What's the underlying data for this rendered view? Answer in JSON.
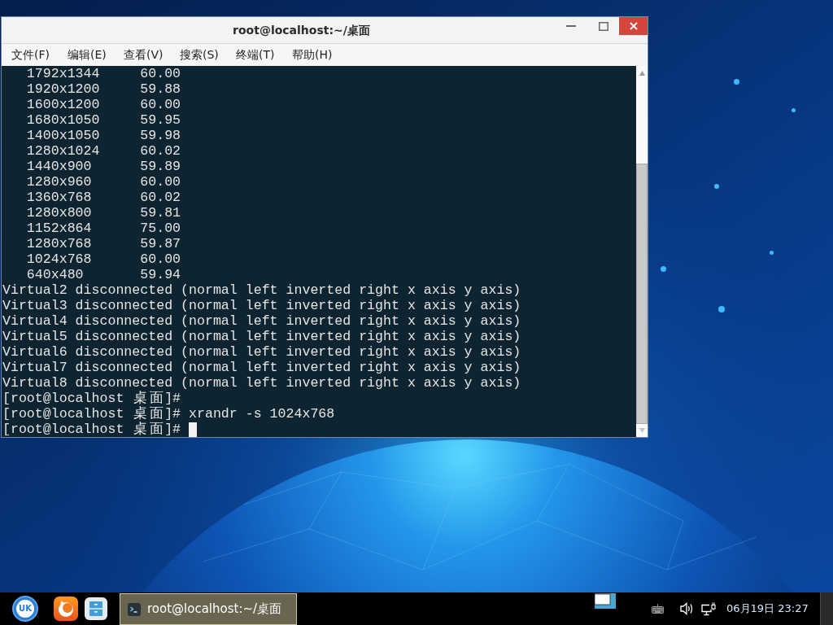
{
  "window": {
    "title": "root@localhost:~/桌面"
  },
  "menu": [
    {
      "label": "文件(F)"
    },
    {
      "label": "编辑(E)"
    },
    {
      "label": "查看(V)"
    },
    {
      "label": "搜索(S)"
    },
    {
      "label": "终端(T)"
    },
    {
      "label": "帮助(H)"
    }
  ],
  "terminal": {
    "modes": [
      {
        "resolution": "1792x1344",
        "rate": "60.00"
      },
      {
        "resolution": "1920x1200",
        "rate": "59.88"
      },
      {
        "resolution": "1600x1200",
        "rate": "60.00"
      },
      {
        "resolution": "1680x1050",
        "rate": "59.95"
      },
      {
        "resolution": "1400x1050",
        "rate": "59.98"
      },
      {
        "resolution": "1280x1024",
        "rate": "60.02"
      },
      {
        "resolution": "1440x900",
        "rate": "59.89"
      },
      {
        "resolution": "1280x960",
        "rate": "60.00"
      },
      {
        "resolution": "1360x768",
        "rate": "60.02"
      },
      {
        "resolution": "1280x800",
        "rate": "59.81"
      },
      {
        "resolution": "1152x864",
        "rate": "75.00"
      },
      {
        "resolution": "1280x768",
        "rate": "59.87"
      },
      {
        "resolution": "1024x768",
        "rate": "60.00"
      },
      {
        "resolution": "640x480",
        "rate": "59.94"
      }
    ],
    "lines": [
      "Virtual2 disconnected (normal left inverted right x axis y axis)",
      "Virtual3 disconnected (normal left inverted right x axis y axis)",
      "Virtual4 disconnected (normal left inverted right x axis y axis)",
      "Virtual5 disconnected (normal left inverted right x axis y axis)",
      "Virtual6 disconnected (normal left inverted right x axis y axis)",
      "Virtual7 disconnected (normal left inverted right x axis y axis)",
      "Virtual8 disconnected (normal left inverted right x axis y axis)"
    ],
    "prompts": [
      {
        "prompt": "[root@localhost 桌面]#",
        "cursor": false
      },
      {
        "prompt": "[root@localhost 桌面]#",
        "command": "xrandr -s 1024x768",
        "cursor": false
      },
      {
        "prompt": "[root@localhost 桌面]#",
        "cursor": true
      }
    ]
  },
  "taskbar": {
    "start_button": {
      "label": "UK"
    },
    "tasks": [
      {
        "title": "root@localhost:~/桌面",
        "selected": true
      }
    ],
    "clock": "06月19日 23:27"
  }
}
